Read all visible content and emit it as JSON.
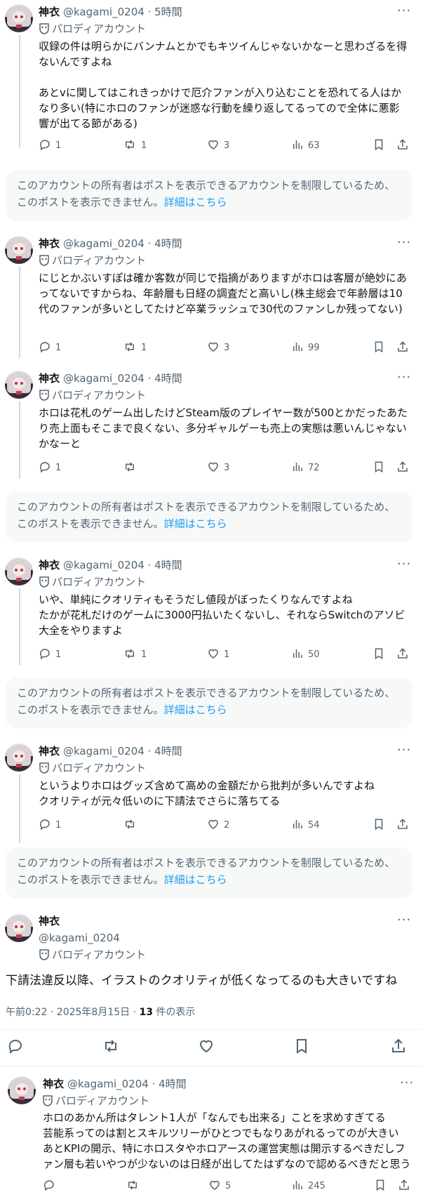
{
  "colors": {
    "accent": "#1d9bf0",
    "muted": "#536471",
    "text": "#0f1419",
    "restricted_bg": "#f7f9f9"
  },
  "icons": [
    "reply-icon",
    "repost-icon",
    "like-icon",
    "views-icon",
    "bookmark-icon",
    "share-icon",
    "more-icon",
    "parody-mask-icon"
  ],
  "posts": [
    {
      "name": "神衣",
      "handle": "@kagami_0204 · 5時間",
      "parody": "パロディアカウント",
      "text": "収録の件は明らかにバンナムとかでもキツイんじゃないかなーと思わざるを得ないんですよね\n\nあとvに関してはこれきっかけで厄介ファンが入り込むことを恐れてる人はかなり多い(特にホロのファンが迷惑な行動を繰り返してるってので全体に悪影響が出てる節がある)",
      "replies": "1",
      "reposts": "1",
      "likes": "3",
      "views": "63"
    },
    {
      "name": "神衣",
      "handle": "@kagami_0204 · 4時間",
      "parody": "パロディアカウント",
      "text": "にじとかぶいすぽは確か客数が同じで指摘がありますがホロは客層が絶妙にあってないですからね、年齢層も日経の調査だと高いし(株主総会で年齢層は10代のファンが多いとしてたけど卒業ラッシュで30代のファンしか残ってない)",
      "replies": "1",
      "reposts": "1",
      "likes": "3",
      "views": "99"
    },
    {
      "name": "神衣",
      "handle": "@kagami_0204 · 4時間",
      "parody": "パロディアカウント",
      "text": "ホロは花札のゲーム出したけどSteam版のプレイヤー数が500とかだったあたり売上面もそこまで良くない、多分ギャルゲーも売上の実態は悪いんじゃないかなーと",
      "replies": "1",
      "reposts": "",
      "likes": "3",
      "views": "72"
    },
    {
      "name": "神衣",
      "handle": "@kagami_0204 · 4時間",
      "parody": "パロディアカウント",
      "text": "いや、単純にクオリティもそうだし値段がぼったくりなんですよね\nたかが花札だけのゲームに3000円払いたくないし、それならSwitchのアソビ大全をやりますよ",
      "replies": "1",
      "reposts": "1",
      "likes": "1",
      "views": "50"
    },
    {
      "name": "神衣",
      "handle": "@kagami_0204 · 4時間",
      "parody": "パロディアカウント",
      "text": "というよりホロはグッズ含めて高めの金額だから批判が多いんですよね\nクオリティが元々低いのに下請法でさらに落ちてる",
      "replies": "1",
      "reposts": "",
      "likes": "2",
      "views": "54"
    }
  ],
  "restricted": {
    "text": "このアカウントの所有者はポストを表示できるアカウントを制限しているため、このポストを表示できません。",
    "link": "詳細はこちら"
  },
  "main_post": {
    "name": "神衣",
    "handle": "@kagami_0204",
    "parody": "パロディアカウント",
    "text": "下請法違反以降、イラストのクオリティが低くなってるのも大きいですね",
    "time": "午前0:22 · 2025年8月15日 · ",
    "views_count": "13",
    "views_label": " 件の表示"
  },
  "reply_post": {
    "name": "神衣",
    "handle": "@kagami_0204 · 4時間",
    "parody": "パロディアカウント",
    "text": "ホロのあかん所はタレント1人が「なんでも出来る」ことを求めすぎてる\n芸能系ってのは割とスキルツリーがひとつでもなりあがれるってのが大きい\nあとKPIの開示、特にホロスタやホロアースの運営実態は開示するべきだしファン層も若いやつが少ないのは日経が出してたはずなので認めるべきだと思う",
    "replies": "",
    "reposts": "",
    "likes": "5",
    "views": "245"
  }
}
